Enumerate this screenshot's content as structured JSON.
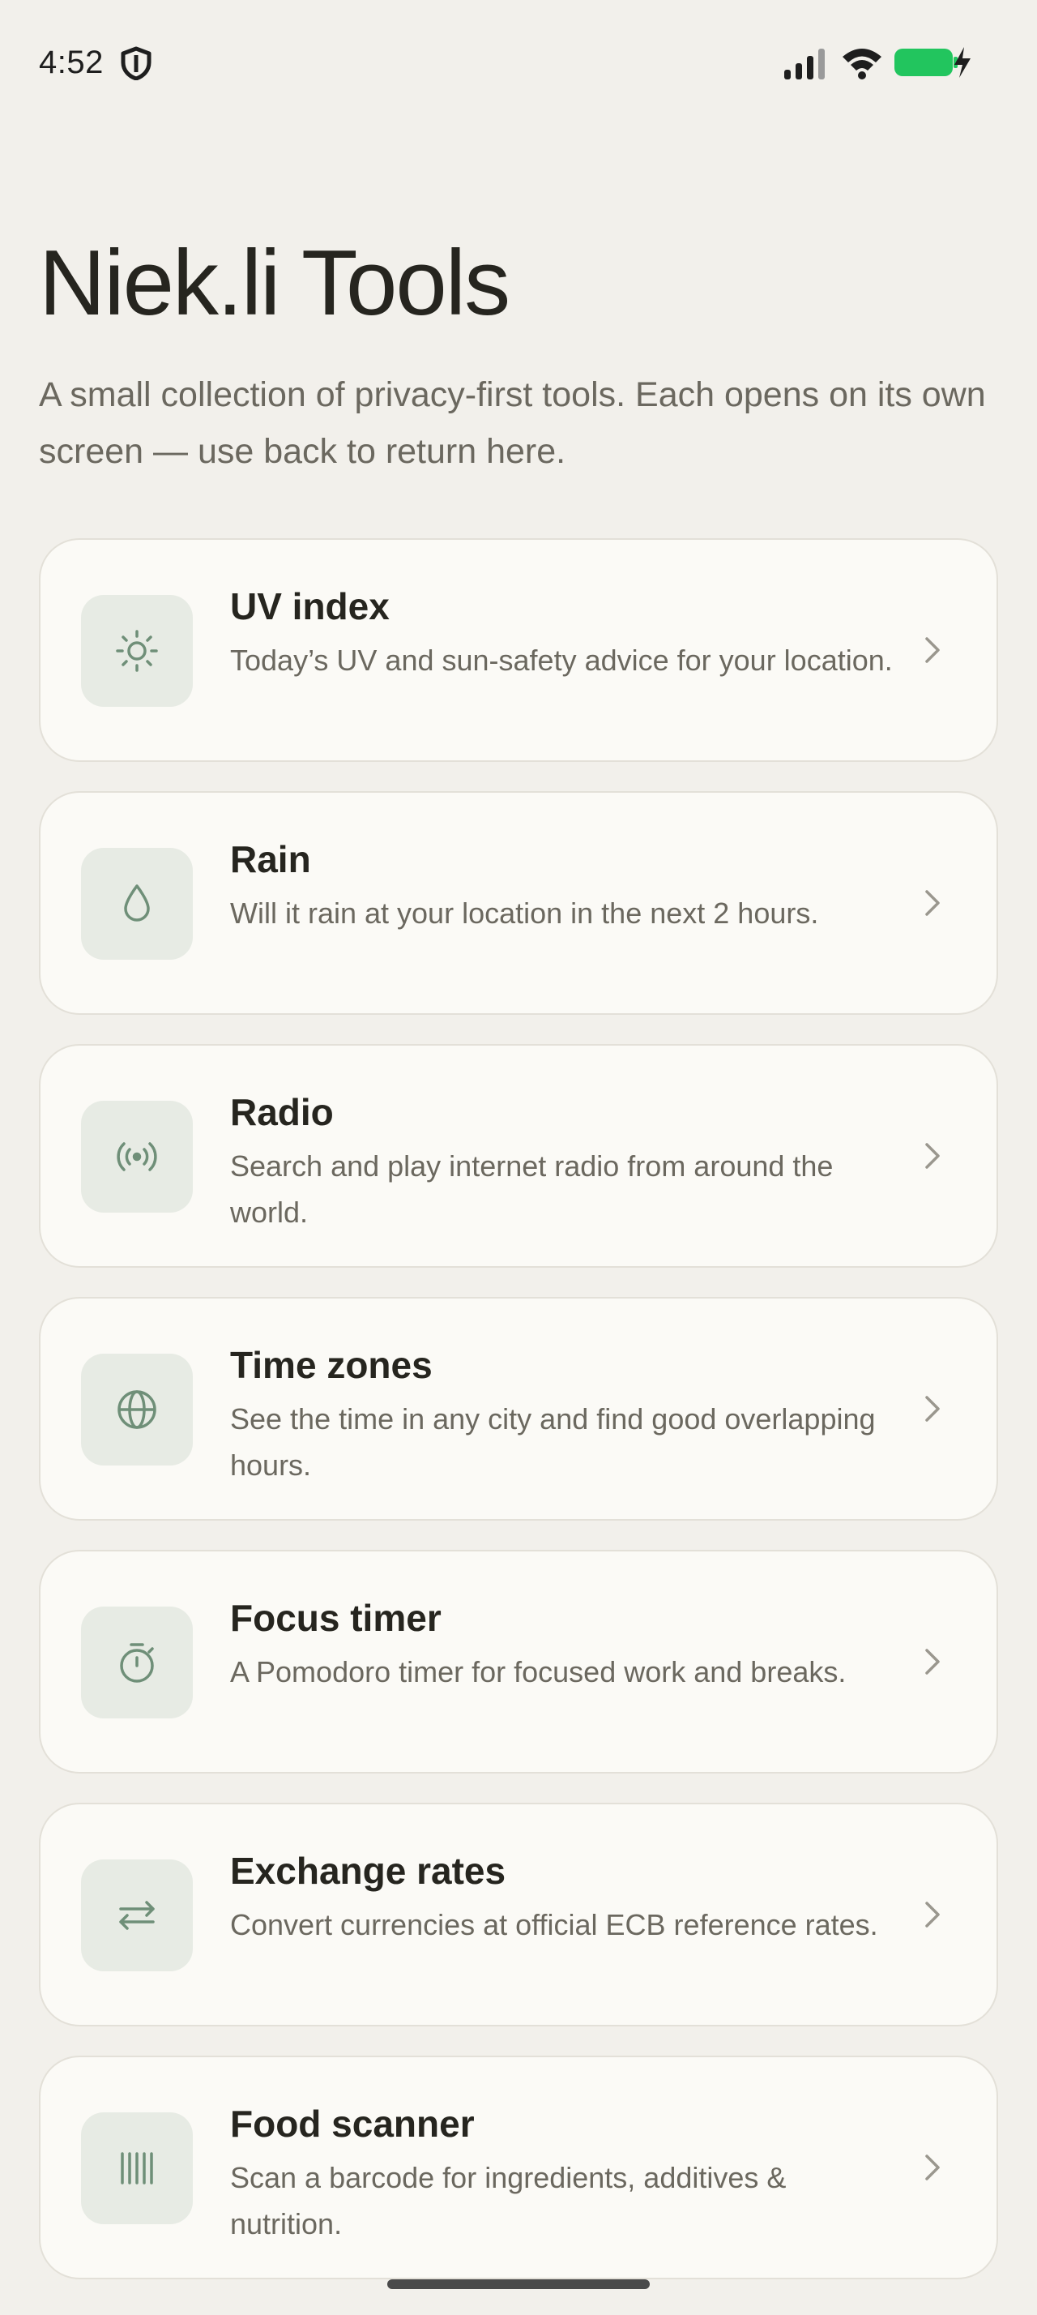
{
  "status_bar": {
    "time": "4:52",
    "icons": [
      "shield-icon",
      "signal-icon",
      "wifi-icon",
      "battery-charging-icon"
    ],
    "battery_color": "#22c55e"
  },
  "header": {
    "title": "Niek.li Tools",
    "intro": "A small collection of privacy-first tools. Each opens on its own screen — use back to return here."
  },
  "tools": [
    {
      "name": "UV index",
      "description": "Today’s UV and sun-safety advice for your location.",
      "icon": "sun-icon"
    },
    {
      "name": "Rain",
      "description": "Will it rain at your location in the next 2 hours.",
      "icon": "droplet-icon"
    },
    {
      "name": "Radio",
      "description": "Search and play internet radio from around the world.",
      "icon": "radio-broadcast-icon"
    },
    {
      "name": "Time zones",
      "description": "See the time in any city and find good overlapping hours.",
      "icon": "globe-icon"
    },
    {
      "name": "Focus timer",
      "description": "A Pomodoro timer for focused work and breaks.",
      "icon": "stopwatch-icon"
    },
    {
      "name": "Exchange rates",
      "description": "Convert currencies at official ECB reference rates.",
      "icon": "exchange-arrows-icon"
    },
    {
      "name": "Food scanner",
      "description": "Scan a barcode for ingredients, additives & nutrition.",
      "icon": "barcode-icon"
    }
  ],
  "theme": {
    "background": "#f2f0eb",
    "card": "#fbfaf6",
    "icon_tint": "#6f8f78",
    "icon_box": "#e7ebe4"
  }
}
